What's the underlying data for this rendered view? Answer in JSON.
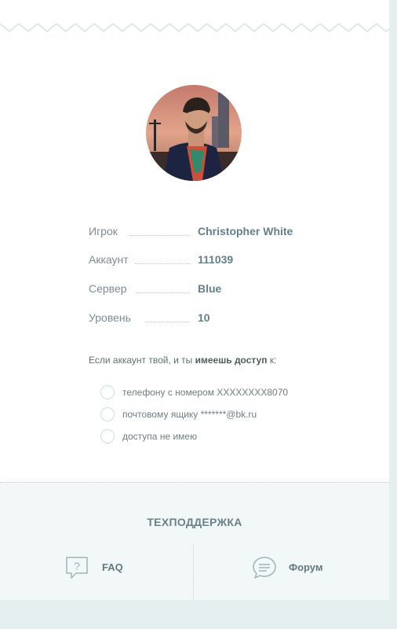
{
  "profile": {
    "rows": [
      {
        "label": "Игрок",
        "value": "Christopher  White"
      },
      {
        "label": "Аккаунт",
        "value": "111039"
      },
      {
        "label": "Сервер",
        "value": "Blue"
      },
      {
        "label": "Уровень",
        "value": "10"
      }
    ]
  },
  "access": {
    "question_prefix": "Если аккаунт твой, и ты ",
    "question_bold": "имеешь доступ",
    "question_suffix": " к:",
    "options": [
      "телефону с номером XXXXXXXX8070",
      "почтовому ящику *******@bk.ru",
      "доступа не имею"
    ]
  },
  "support": {
    "title": "ТЕХПОДДЕРЖКА",
    "faq_label": "FAQ",
    "forum_label": "Форум",
    "faq_icon": "question-bubble-icon",
    "forum_icon": "chat-bubble-icon"
  },
  "colors": {
    "accent": "#65808a",
    "background": "#e6eff0",
    "support_bg": "#f2f7f8"
  }
}
